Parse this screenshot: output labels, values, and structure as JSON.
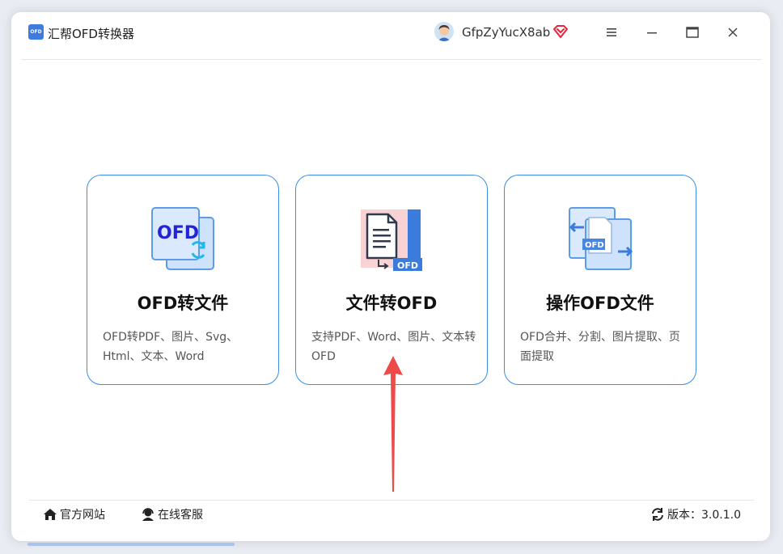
{
  "app": {
    "title": "汇帮OFD转换器",
    "logo_text": "OFD"
  },
  "user": {
    "name": "GfpZyYucX8ab"
  },
  "cards": [
    {
      "title": "OFD转文件",
      "description": "OFD转PDF、图片、Svg、Html、文本、Word",
      "icon": "ofd-convert-icon"
    },
    {
      "title": "文件转OFD",
      "description": "支持PDF、Word、图片、文本转OFD",
      "icon": "file-to-ofd-icon"
    },
    {
      "title": "操作OFD文件",
      "description": "OFD合并、分割、图片提取、页面提取",
      "icon": "ofd-operate-icon"
    }
  ],
  "footer": {
    "website": "官方网站",
    "support": "在线客服",
    "version": "版本：3.0.1.0"
  },
  "colors": {
    "accent": "#3a8ee6",
    "arrow": "#ef4a4a",
    "vip": "#e8253a"
  }
}
